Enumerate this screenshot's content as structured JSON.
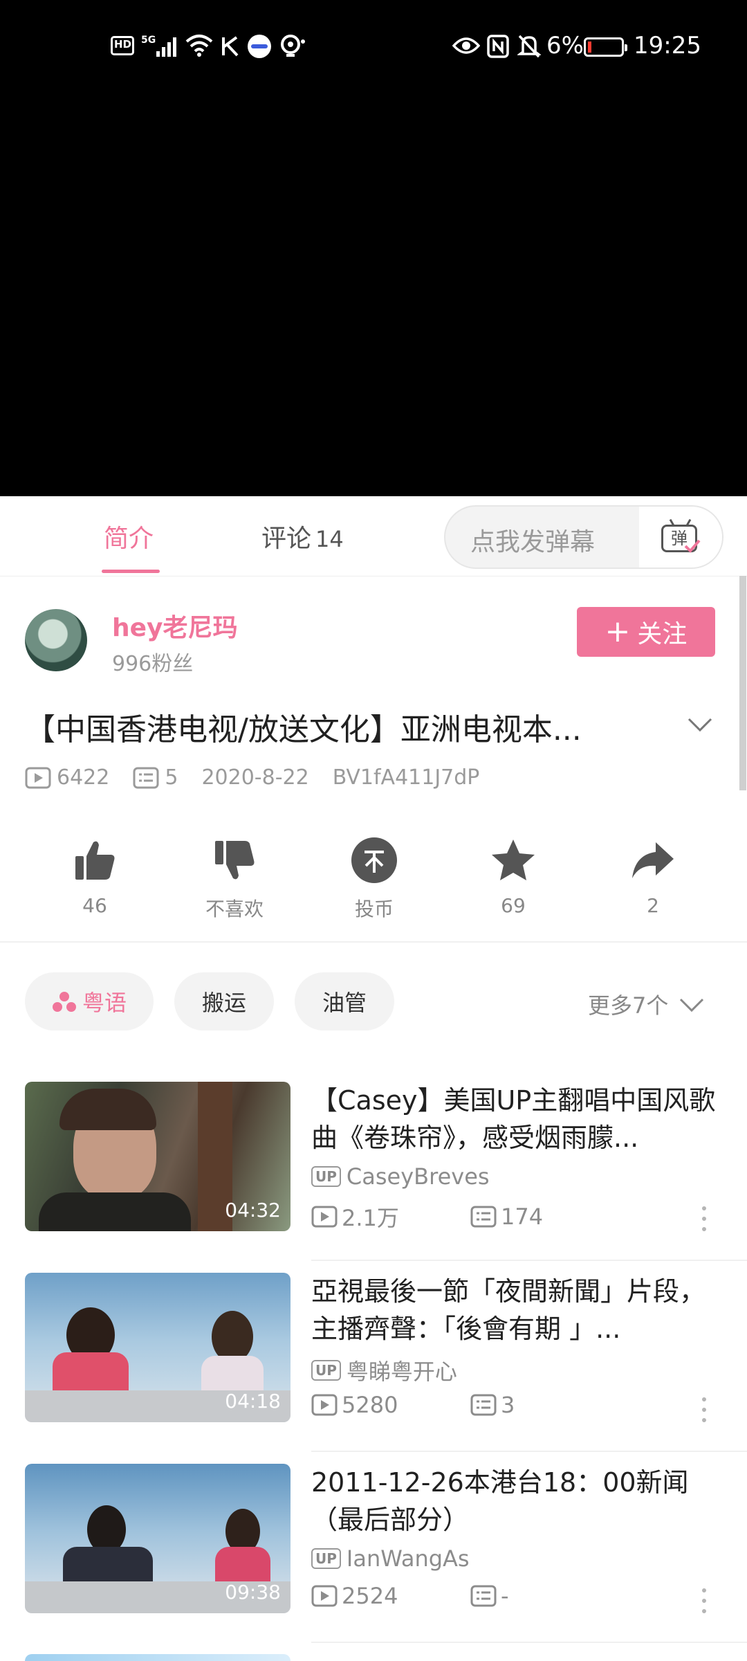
{
  "status_bar": {
    "left_icons": [
      "hd-icon",
      "5g-signal-icon",
      "wifi-icon",
      "k-app-icon",
      "app-indicator-icon",
      "camera-indicator-icon"
    ],
    "right_icons": [
      "eye-icon",
      "nfc-icon",
      "mute-icon"
    ],
    "battery": "6%",
    "time": "19:25",
    "hd_label": "HD"
  },
  "tabs": {
    "intro": "简介",
    "comments": "评论",
    "comments_count": "14",
    "danmaku_placeholder": "点我发弹幕",
    "danmaku_button_char": "弹"
  },
  "uploader": {
    "name": "hey老尼玛",
    "fans": "996粉丝",
    "follow_label": "关注",
    "follow_plus": "+"
  },
  "video": {
    "title": "【中国香港电视/放送文化】亚洲电视本...",
    "views": "6422",
    "danmaku_count": "5",
    "date": "2020-8-22",
    "bvid": "BV1fA411J7dP"
  },
  "actions": [
    {
      "icon": "thumbs-up-icon",
      "label": "46"
    },
    {
      "icon": "thumbs-down-icon",
      "label": "不喜欢"
    },
    {
      "icon": "coin-icon",
      "label": "投币"
    },
    {
      "icon": "star-icon",
      "label": "69"
    },
    {
      "icon": "share-icon",
      "label": "2"
    }
  ],
  "tags": [
    "粤语",
    "搬运",
    "油管"
  ],
  "more_tags": "更多7个",
  "recommendations": [
    {
      "title": "【Casey】美国UP主翻唱中国风歌曲《卷珠帘》，感受烟雨朦...",
      "up": "CaseyBreves",
      "views": "2.1万",
      "comments": "174",
      "duration": "04:32"
    },
    {
      "title": "亞視最後一節「夜間新聞」片段，主播齊聲：「後會有期 」...",
      "up": "粤睇粤开心",
      "views": "5280",
      "comments": "3",
      "duration": "04:18"
    },
    {
      "title": "2011-12-26本港台18：00新闻（最后部分）",
      "up": "IanWangAs",
      "views": "2524",
      "comments": "-",
      "duration": "09:38"
    }
  ],
  "up_badge": "UP",
  "colors": {
    "accent": "#f0759a",
    "secondary_text": "#9a9a9a",
    "video_bg": "#000000"
  }
}
